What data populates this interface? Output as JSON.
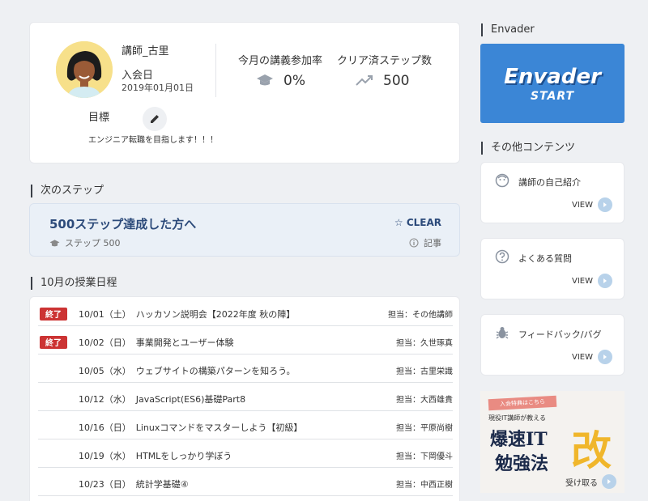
{
  "profile": {
    "name": "講師_古里",
    "join_label": "入会日",
    "join_date": "2019年01月01日",
    "goal_label": "目標",
    "goal_text": "エンジニア転職を目指します！！！",
    "stats": [
      {
        "label": "今月の講義参加率",
        "value": "0%",
        "icon": "graduation-cap-icon"
      },
      {
        "label": "クリア済ステップ数",
        "value": "500",
        "icon": "trending-up-icon"
      }
    ]
  },
  "next_step": {
    "heading": "次のステップ",
    "title": "500ステップ達成した方へ",
    "clear_label": "CLEAR",
    "step_label": "ステップ 500",
    "article_label": "記事"
  },
  "schedule": {
    "heading": "10月の授業日程",
    "rows": [
      {
        "badge": "終了",
        "date": "10/01（土）",
        "title": "ハッカソン説明会【2022年度 秋の陣】",
        "tanto": "担当：その他講師"
      },
      {
        "badge": "終了",
        "date": "10/02（日）",
        "title": "事業開発とユーザー体験",
        "tanto": "担当：久世琢真"
      },
      {
        "badge": "",
        "date": "10/05（水）",
        "title": "ウェブサイトの構築パターンを知ろう。",
        "tanto": "担当：古里栄識"
      },
      {
        "badge": "",
        "date": "10/12（水）",
        "title": "JavaScript(ES6)基礎Part8",
        "tanto": "担当：大西雄貴"
      },
      {
        "badge": "",
        "date": "10/16（日）",
        "title": "Linuxコマンドをマスターしよう【初級】",
        "tanto": "担当：平原尚樹"
      },
      {
        "badge": "",
        "date": "10/19（水）",
        "title": "HTMLをしっかり学ぼう",
        "tanto": "担当：下岡優斗"
      },
      {
        "badge": "",
        "date": "10/23（日）",
        "title": "統計学基礎④",
        "tanto": "担当：中西正樹"
      }
    ]
  },
  "sidebar": {
    "envader_heading": "Envader",
    "envader_logo": "Envader",
    "envader_start": "START",
    "other_heading": "その他コンテンツ",
    "cards": [
      {
        "title": "講師の自己紹介",
        "view": "VIEW",
        "icon": "face-icon"
      },
      {
        "title": "よくある質問",
        "view": "VIEW",
        "icon": "question-icon"
      },
      {
        "title": "フィードバック/バグ",
        "view": "VIEW",
        "icon": "bug-icon"
      }
    ],
    "promo": {
      "tag": "入会特典はこちら",
      "sub": "現役IT講師が教える",
      "big1": "爆速IT",
      "big2": "勉強法",
      "kai": "改",
      "get": "受け取る"
    }
  },
  "colors": {
    "accent": "#2c4a7a",
    "badge": "#cc3333",
    "envader": "#3b86d6"
  }
}
